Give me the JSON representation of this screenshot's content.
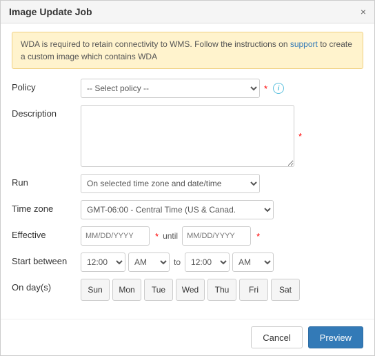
{
  "dialog": {
    "title": "Image Update Job",
    "close_label": "×"
  },
  "alert": {
    "message_part1": "WDA is required to retain connectivity to WMS. Follow the instructions on ",
    "link_text": "support",
    "message_part2": " to create a custom image which contains WDA"
  },
  "form": {
    "policy_label": "Policy",
    "policy_placeholder": "-- Select policy --",
    "description_label": "Description",
    "run_label": "Run",
    "run_options": [
      "On selected time zone and date/time"
    ],
    "run_selected": "On selected time zone and date/time",
    "timezone_label": "Time zone",
    "timezone_selected": "GMT-06:00 - Central Time (US & Canad.",
    "effective_label": "Effective",
    "effective_placeholder": "MM/DD/YYYY",
    "until_label": "until",
    "effective_until_placeholder": "MM/DD/YYYY",
    "start_between_label": "Start between",
    "time_start_hour": "12:00",
    "time_start_ampm": "AM",
    "to_label": "to",
    "time_end_hour": "12:00",
    "time_end_ampm": "AM",
    "on_days_label": "On day(s)",
    "days": [
      "Sun",
      "Mon",
      "Tue",
      "Wed",
      "Thu",
      "Fri",
      "Sat"
    ]
  },
  "footer": {
    "cancel_label": "Cancel",
    "preview_label": "Preview"
  }
}
